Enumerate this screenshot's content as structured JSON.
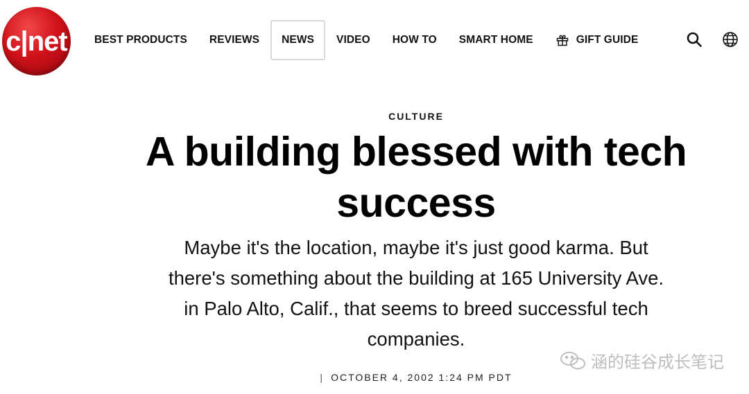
{
  "brand": {
    "logo_text": "c|net",
    "color": "#d1121a"
  },
  "nav": {
    "items": [
      {
        "label": "BEST PRODUCTS"
      },
      {
        "label": "REVIEWS"
      },
      {
        "label": "NEWS",
        "active": true
      },
      {
        "label": "VIDEO"
      },
      {
        "label": "HOW TO"
      },
      {
        "label": "SMART HOME"
      },
      {
        "label": "GIFT GUIDE",
        "icon": "gift-icon"
      }
    ],
    "right_icons": [
      "search-icon",
      "globe-icon"
    ]
  },
  "article": {
    "kicker": "CULTURE",
    "headline_line1": "A building blessed with tech",
    "headline_line2": "success",
    "deck_lines": [
      "Maybe it's the location, maybe it's just good karma. But",
      "there's something about the building at 165 University Ave.",
      "in Palo Alto, Calif., that seems to breed successful tech",
      "companies."
    ],
    "byline_sep": "|",
    "date": "OCTOBER 4, 2002 1:24 PM PDT"
  },
  "watermark": {
    "text": "涵的硅谷成长笔记"
  }
}
